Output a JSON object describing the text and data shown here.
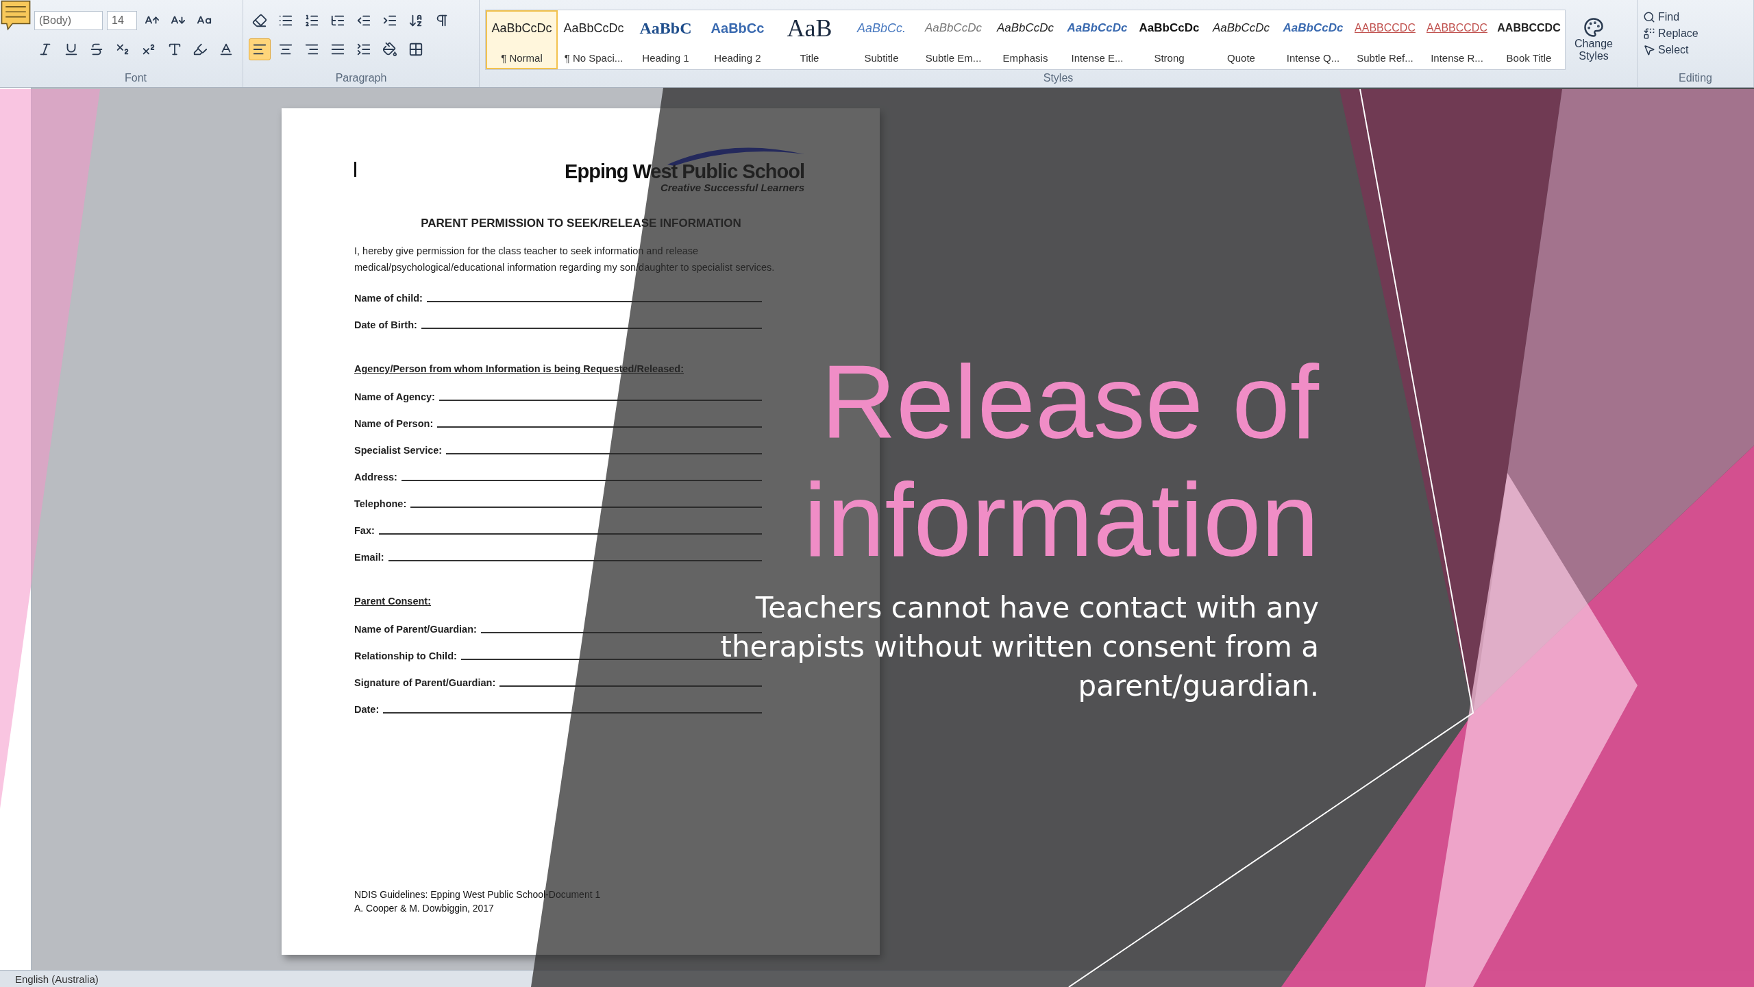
{
  "ribbon": {
    "font": {
      "label": "Font",
      "font_name": "(Body)",
      "font_size": "14"
    },
    "paragraph": {
      "label": "Paragraph",
      "align": [
        {
          "kind": "left",
          "selected": true
        },
        {
          "kind": "center",
          "selected": false
        },
        {
          "kind": "right",
          "selected": false
        },
        {
          "kind": "justify",
          "selected": false
        }
      ]
    },
    "styles": {
      "label": "Styles",
      "items": [
        {
          "preview": "AaBbCcDc",
          "name": "¶ Normal",
          "kind": "normal",
          "selected": true
        },
        {
          "preview": "AaBbCcDc",
          "name": "¶ No Spaci...",
          "kind": "normal",
          "selected": false
        },
        {
          "preview": "AaBbC",
          "name": "Heading 1",
          "kind": "heading1",
          "selected": false
        },
        {
          "preview": "AaBbCc",
          "name": "Heading 2",
          "kind": "heading2",
          "selected": false
        },
        {
          "preview": "AaB",
          "name": "Title",
          "kind": "title",
          "selected": false
        },
        {
          "preview": "AaBbCc.",
          "name": "Subtitle",
          "kind": "subtitle",
          "selected": false
        },
        {
          "preview": "AaBbCcDc",
          "name": "Subtle Em...",
          "kind": "subtle",
          "selected": false
        },
        {
          "preview": "AaBbCcDc",
          "name": "Emphasis",
          "kind": "emphasis",
          "selected": false
        },
        {
          "preview": "AaBbCcDc",
          "name": "Intense E...",
          "kind": "intense",
          "selected": false
        },
        {
          "preview": "AaBbCcDc",
          "name": "Strong",
          "kind": "strong",
          "selected": false
        },
        {
          "preview": "AaBbCcDc",
          "name": "Quote",
          "kind": "emphasis",
          "selected": false
        },
        {
          "preview": "AaBbCcDc",
          "name": "Intense Q...",
          "kind": "intense",
          "selected": false
        },
        {
          "preview": "AABBCCDC",
          "name": "Subtle Ref...",
          "kind": "ref",
          "selected": false
        },
        {
          "preview": "AABBCCDC",
          "name": "Intense R...",
          "kind": "ref",
          "selected": false
        },
        {
          "preview": "AABBCCDC",
          "name": "Book Title",
          "kind": "book",
          "selected": false
        }
      ]
    },
    "change_styles": "Change Styles",
    "editing": {
      "label": "Editing",
      "items": [
        {
          "label": "Find",
          "kind": "find"
        },
        {
          "label": "Replace",
          "kind": "replace"
        },
        {
          "label": "Select",
          "kind": "select"
        }
      ]
    }
  },
  "document": {
    "logo": {
      "name": "Epping West Public School",
      "tagline": "Creative Successful Learners"
    },
    "heading": "PARENT PERMISSION TO SEEK/RELEASE INFORMATION",
    "intro": "I, hereby give permission for the class teacher to seek information and release medical/psychological/educational information regarding my son/daughter to specialist services.",
    "sections": [
      {
        "fields": [
          "Name of child:",
          "Date of Birth:"
        ]
      },
      {
        "heading": "Agency/Person from whom Information is being Requested/Released:",
        "fields": [
          "Name of Agency:",
          "Name of Person:",
          "Specialist Service:",
          "Address:",
          "Telephone:",
          "Fax:",
          "Email:"
        ]
      },
      {
        "heading": "Parent Consent:",
        "fields": [
          "Name of Parent/Guardian:",
          "Relationship to Child:",
          "Signature of Parent/Guardian:",
          "Date:"
        ]
      }
    ],
    "footer": [
      "NDIS Guidelines: Epping West Public School-Document 1",
      "A. Cooper & M. Dowbiggin, 2017"
    ]
  },
  "status_bar": {
    "language": "English (Australia)"
  },
  "slide": {
    "title": "Release of information",
    "subtitle": "Teachers cannot have contact with any therapists without written consent from a parent/guardian."
  }
}
